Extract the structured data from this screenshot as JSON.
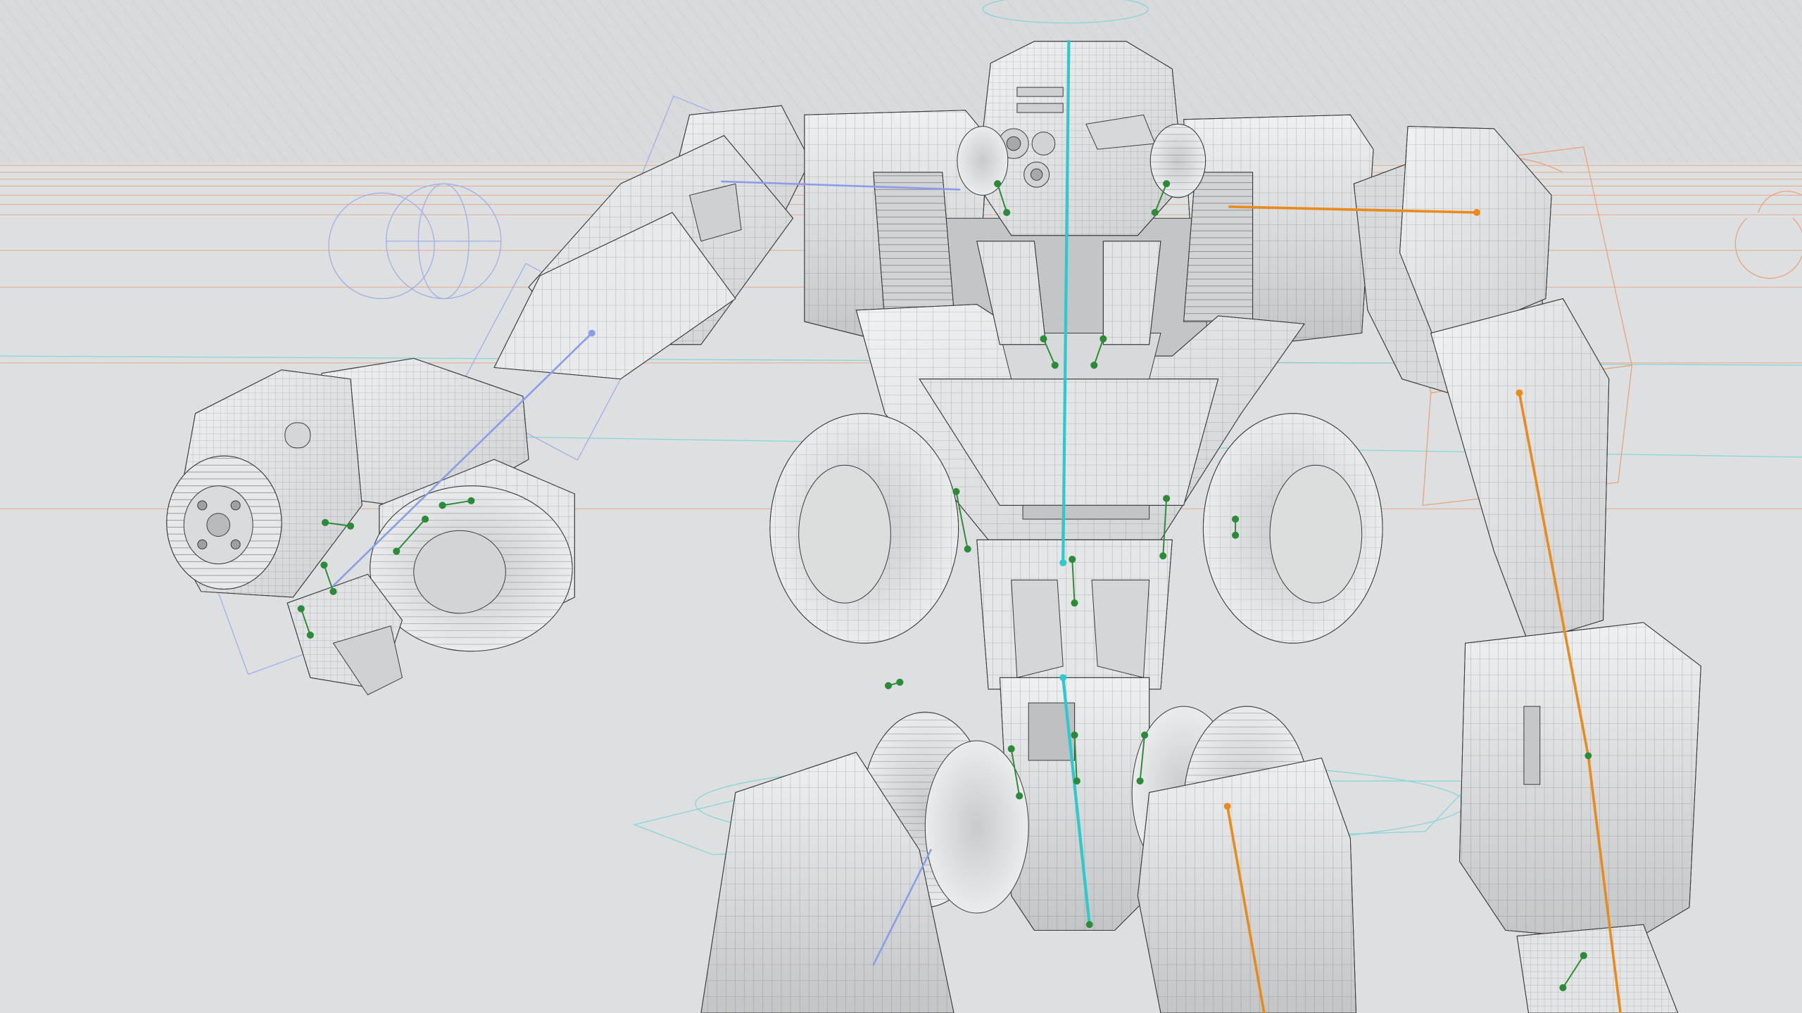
{
  "viewport": {
    "colors": {
      "background": "#dedfe0",
      "background_band": "#d7d8d9",
      "hatch": "#c9cacb",
      "mesh_fill": "#e6e7e8",
      "mesh_fill_light": "#eeeff0",
      "mesh_fill_dark": "#c8c9ca",
      "mesh_shadow": "#a9aaab",
      "wire": "#3b3c3e",
      "wire_light": "#6c6d70",
      "bone_center": "#2ec9cf",
      "bone_right": "#e88a1c",
      "bone_left": "#8a9ee8",
      "joint": "#2d8a3a",
      "guide_orange": "#e6a47e",
      "guide_cyan": "#7fd4d8",
      "guide_blue": "#9fb0e6"
    }
  }
}
